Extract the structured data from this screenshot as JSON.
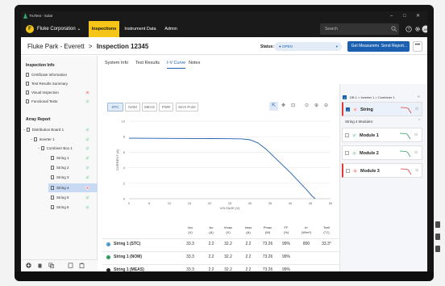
{
  "window": {
    "title": "TruTest - Solar",
    "minimize": "–",
    "maximize": "□",
    "close": "✕"
  },
  "topnav": {
    "logo": "F",
    "org": "Fluke Corporation ⌄",
    "tabs": [
      "Inspections",
      "Instrument Data",
      "Admin"
    ],
    "search_placeholder": "Search"
  },
  "header": {
    "breadcrumb_parent": "Fluke Park - Everett",
    "breadcrumb_sep": ">",
    "breadcrumb_current": "Inspection 12345",
    "status_label": "Status:",
    "status_value": "● OPEN",
    "status_chevron": "▾",
    "get_measurements": "Get Measurements...",
    "send_report": "Send Report...",
    "more": "•••"
  },
  "sidebar": {
    "inspection_info": "Inspection Info",
    "info_items": [
      "Certificate Information",
      "Test Results Summary",
      "Visual Inspection",
      "Functional Tests"
    ],
    "array_report": "Array Report",
    "tree": [
      "Distribution Board 1",
      "Inverter 1",
      "Combiner Box 1",
      "String 1",
      "String 2",
      "String 3",
      "String 4",
      "String 5",
      "String 6"
    ]
  },
  "subtabs": [
    "System Info",
    "Test Results",
    "I-V Curve",
    "Notes"
  ],
  "chart_controls": {
    "pills": [
      "STC",
      "NOM",
      "MEAS",
      "PWR",
      "MAX Point"
    ]
  },
  "chart_data": {
    "type": "line",
    "xlabel": "VOLTAGE (V)",
    "ylabel": "CURRENT (A)",
    "xlim": [
      0,
      50
    ],
    "ylim": [
      0,
      10
    ],
    "xticks": [
      0,
      5,
      10,
      15,
      20,
      25,
      30,
      35,
      40,
      45,
      50
    ],
    "yticks": [
      0,
      2,
      4,
      6,
      8,
      10
    ],
    "grid": true,
    "series": [
      {
        "color": "#1b5fb0",
        "x": [
          0,
          5,
          10,
          15,
          20,
          25,
          28,
          30,
          32,
          34,
          36,
          38,
          40,
          42,
          44,
          45.5,
          46.2
        ],
        "y": [
          7.8,
          7.79,
          7.78,
          7.77,
          7.76,
          7.74,
          7.72,
          7.6,
          7.2,
          6.4,
          5.4,
          4.4,
          3.4,
          2.3,
          1.2,
          0.3,
          0
        ]
      }
    ]
  },
  "table": {
    "headers": [
      [
        "Voc",
        "(V)"
      ],
      [
        "Isc",
        "(A)"
      ],
      [
        "Vmax",
        "(V)"
      ],
      [
        "Imax",
        "(A)"
      ],
      [
        "Pmax",
        "(W)"
      ],
      [
        "FF",
        "(%)"
      ],
      [
        "Irr",
        "(W/m²)"
      ],
      [
        "Tcell",
        "(°C)"
      ]
    ],
    "rows": [
      {
        "name": "String 1 (STC)",
        "color": "#4a9bd1",
        "values": [
          "33.3",
          "2.2",
          "32.2",
          "2.2",
          "73.26",
          "99%",
          "800",
          "33.3°"
        ]
      },
      {
        "name": "String 1 (NOM)",
        "color": "#2e9d5a",
        "values": [
          "33.3",
          "2.2",
          "32.2",
          "2.2",
          "73.26",
          "99%",
          "",
          ""
        ]
      },
      {
        "name": "String 1 (MEAS)",
        "color": "#222222",
        "values": [
          "33.3",
          "2.2",
          "32.2",
          "2.2",
          "73.26",
          "99%",
          "",
          ""
        ]
      }
    ]
  },
  "right_panel": {
    "path": "DB 1 > Inverter 1 > Combiner 1",
    "string_card": "String",
    "modules_header": "String 4 Modules:",
    "modules": [
      "Module 1",
      "Module 2",
      "Module 3"
    ]
  }
}
